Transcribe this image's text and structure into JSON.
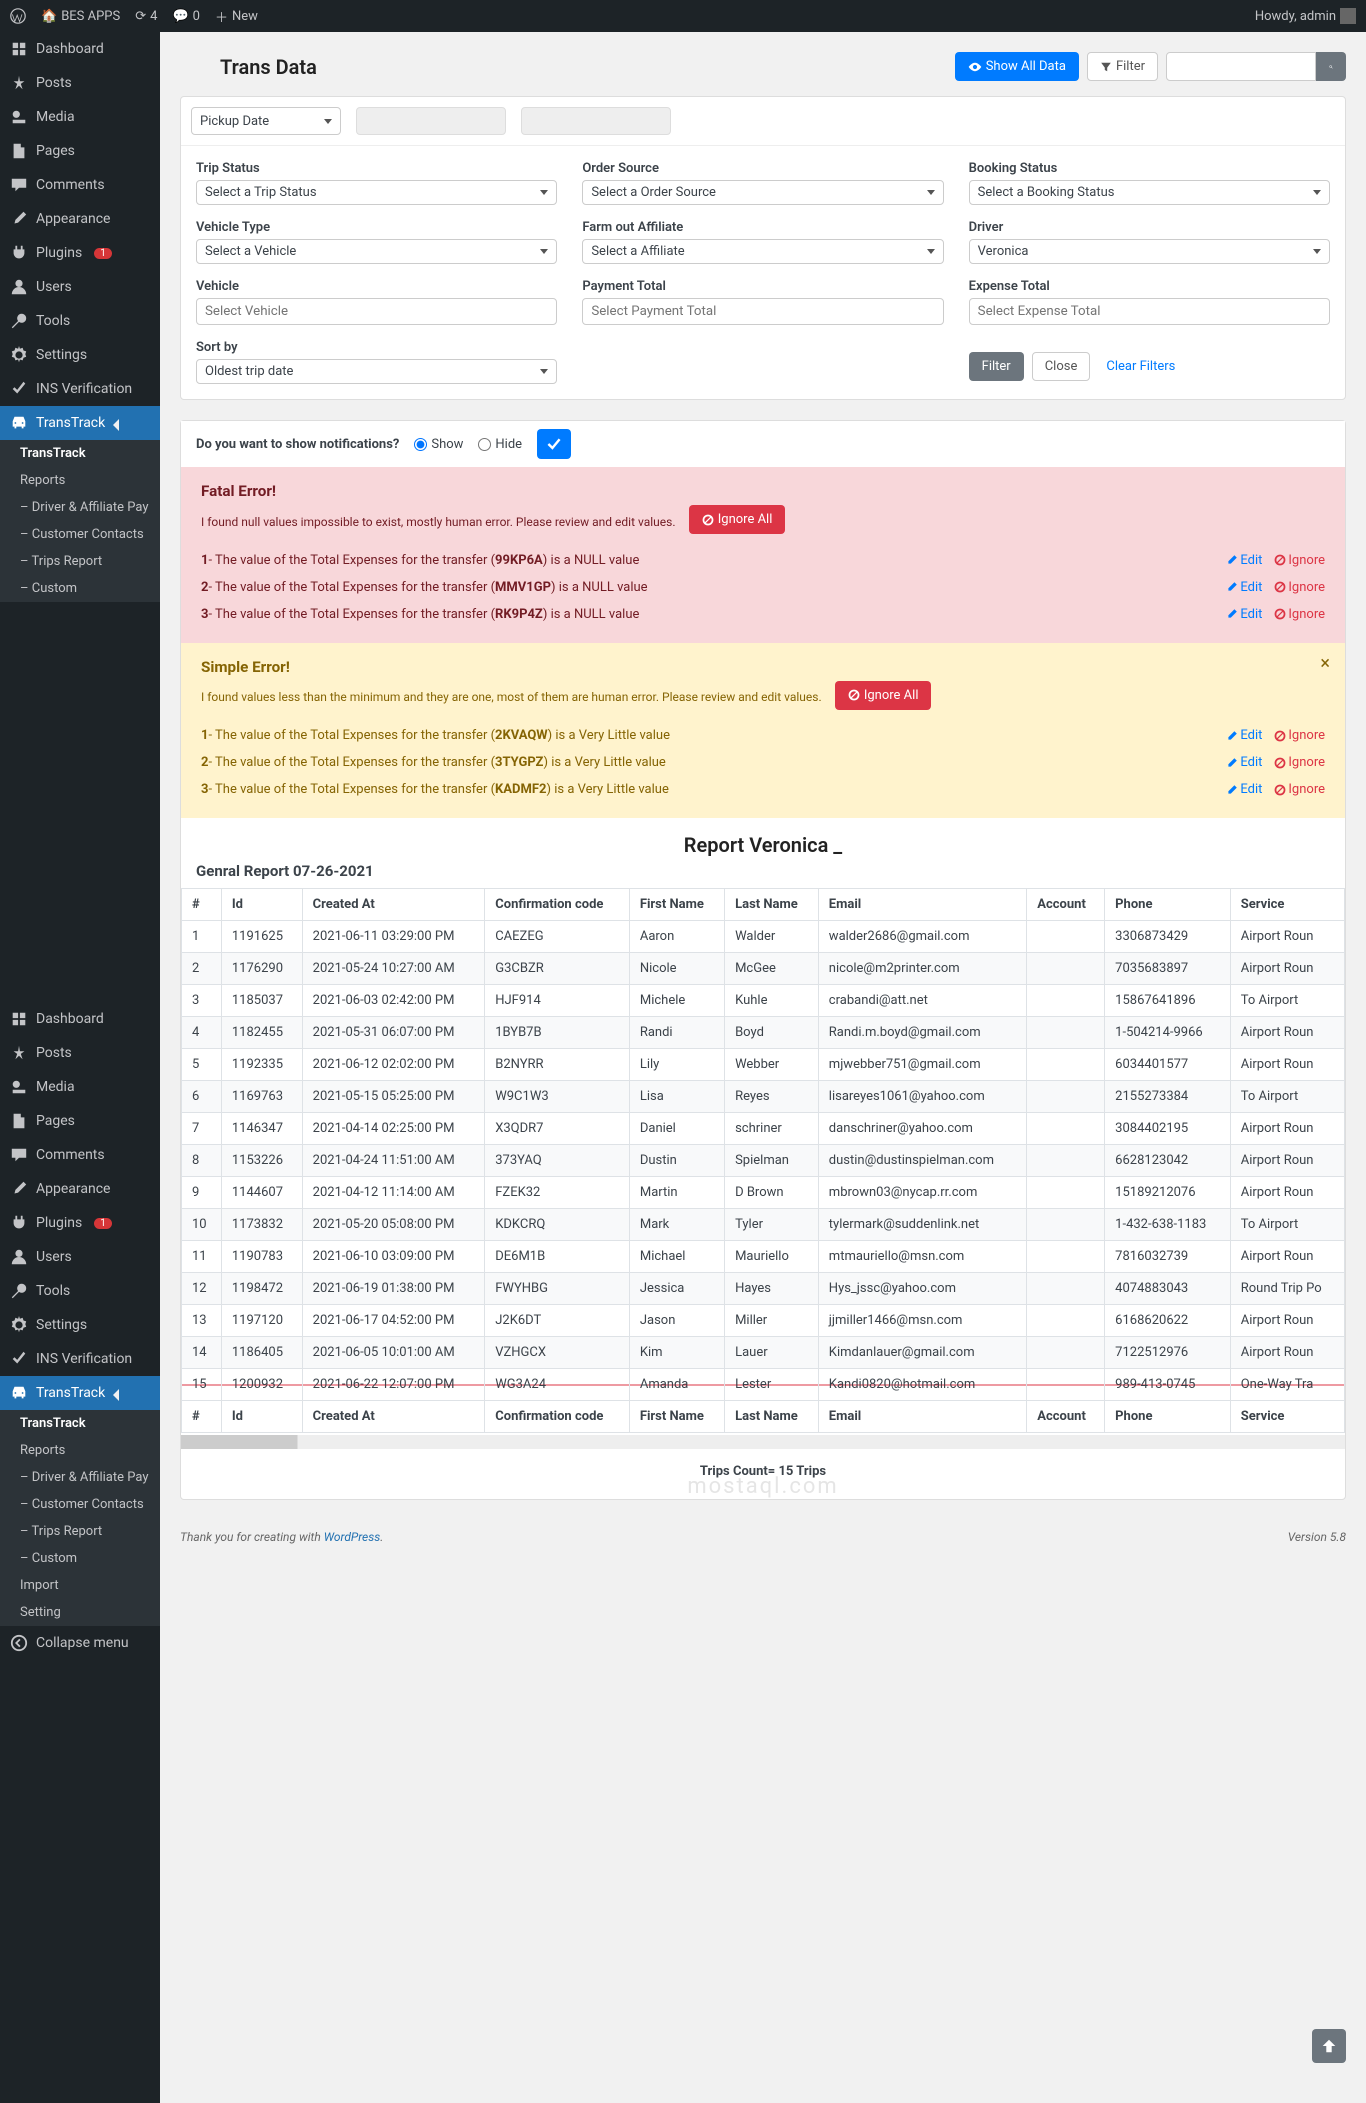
{
  "adminbar": {
    "site_name": "BES APPS",
    "updates": "4",
    "comments": "0",
    "new": "New",
    "howdy": "Howdy, admin"
  },
  "sidebar": {
    "items": [
      {
        "label": "Dashboard",
        "icon": "dash"
      },
      {
        "label": "Posts",
        "icon": "pin"
      },
      {
        "label": "Media",
        "icon": "media"
      },
      {
        "label": "Pages",
        "icon": "page"
      },
      {
        "label": "Comments",
        "icon": "comment"
      },
      {
        "label": "Appearance",
        "icon": "brush"
      },
      {
        "label": "Plugins",
        "icon": "plug",
        "badge": "1"
      },
      {
        "label": "Users",
        "icon": "user"
      },
      {
        "label": "Tools",
        "icon": "tool"
      },
      {
        "label": "Settings",
        "icon": "gear"
      },
      {
        "label": "INS Verification",
        "icon": "check"
      },
      {
        "label": "TransTrack",
        "icon": "car",
        "active": true
      }
    ],
    "submenu": [
      {
        "label": "TransTrack",
        "current": true
      },
      {
        "label": "Reports"
      },
      {
        "label": "– Driver & Affiliate Pay"
      },
      {
        "label": "– Customer Contacts"
      },
      {
        "label": "– Trips Report"
      },
      {
        "label": "– Custom"
      }
    ],
    "bottom": [
      {
        "label": "Dashboard",
        "icon": "dash"
      },
      {
        "label": "Posts",
        "icon": "pin"
      },
      {
        "label": "Media",
        "icon": "media"
      },
      {
        "label": "Pages",
        "icon": "page"
      },
      {
        "label": "Comments",
        "icon": "comment"
      },
      {
        "label": "Appearance",
        "icon": "brush"
      },
      {
        "label": "Plugins",
        "icon": "plug",
        "badge": "1"
      },
      {
        "label": "Users",
        "icon": "user"
      },
      {
        "label": "Tools",
        "icon": "tool"
      },
      {
        "label": "Settings",
        "icon": "gear"
      },
      {
        "label": "INS Verification",
        "icon": "check"
      },
      {
        "label": "TransTrack",
        "icon": "car",
        "active": true
      }
    ],
    "bottom_submenu": [
      {
        "label": "TransTrack",
        "current": true
      },
      {
        "label": "Reports"
      },
      {
        "label": "– Driver & Affiliate Pay"
      },
      {
        "label": "– Customer Contacts"
      },
      {
        "label": "– Trips Report"
      },
      {
        "label": "– Custom"
      },
      {
        "label": "Import"
      },
      {
        "label": "Setting"
      }
    ],
    "collapse": "Collapse menu"
  },
  "page": {
    "title": "Trans Data",
    "show_all": "Show All Data",
    "filter_btn": "Filter",
    "pickup_date": "Pickup Date"
  },
  "filters": {
    "trip_status": {
      "label": "Trip Status",
      "value": "Select a Trip Status"
    },
    "order_source": {
      "label": "Order Source",
      "value": "Select a Order Source"
    },
    "booking_status": {
      "label": "Booking Status",
      "value": "Select a Booking Status"
    },
    "vehicle_type": {
      "label": "Vehicle Type",
      "value": "Select a Vehicle"
    },
    "farm_out": {
      "label": "Farm out Affiliate",
      "value": "Select a Affiliate"
    },
    "driver": {
      "label": "Driver",
      "value": "Veronica"
    },
    "vehicle": {
      "label": "Vehicle",
      "placeholder": "Select Vehicle"
    },
    "payment_total": {
      "label": "Payment Total",
      "placeholder": "Select Payment Total"
    },
    "expense_total": {
      "label": "Expense Total",
      "placeholder": "Select Expense Total"
    },
    "sort_by": {
      "label": "Sort by",
      "value": "Oldest trip date"
    },
    "filter_btn": "Filter",
    "close_btn": "Close",
    "clear": "Clear Filters"
  },
  "notif": {
    "question": "Do you want to show notifications?",
    "show": "Show",
    "hide": "Hide"
  },
  "fatal": {
    "title": "Fatal Error!",
    "subtitle": "I found null values impossible to exist, mostly human error. Please review and edit values.",
    "ignore_all": "Ignore All",
    "items": [
      {
        "n": "1",
        "prefix": "- The value of the Total Expenses for the transfer (",
        "code": "99KP6A",
        "suffix": ") is a NULL value"
      },
      {
        "n": "2",
        "prefix": "- The value of the Total Expenses for the transfer (",
        "code": "MMV1GP",
        "suffix": ") is a NULL value"
      },
      {
        "n": "3",
        "prefix": "- The value of the Total Expenses for the transfer (",
        "code": "RK9P4Z",
        "suffix": ") is a NULL value"
      }
    ],
    "edit": "Edit",
    "ignore": "Ignore"
  },
  "simple": {
    "title": "Simple Error!",
    "subtitle": "I found values less than the minimum and they are one, most of them are human error. Please review and edit values.",
    "ignore_all": "Ignore All",
    "items": [
      {
        "n": "1",
        "prefix": "- The value of the Total Expenses for the transfer (",
        "code": "2KVAQW",
        "suffix": ") is a Very Little value"
      },
      {
        "n": "2",
        "prefix": "- The value of the Total Expenses for the transfer (",
        "code": "3TYGPZ",
        "suffix": ") is a Very Little value"
      },
      {
        "n": "3",
        "prefix": "- The value of the Total Expenses for the transfer (",
        "code": "KADMF2",
        "suffix": ") is a Very Little value"
      }
    ],
    "edit": "Edit",
    "ignore": "Ignore"
  },
  "report": {
    "title": "Report Veronica _",
    "subtitle": "Genral Report 07-26-2021",
    "headers": [
      "#",
      "Id",
      "Created At",
      "Confirmation code",
      "First Name",
      "Last Name",
      "Email",
      "Account",
      "Phone",
      "Service"
    ],
    "rows": [
      {
        "n": "1",
        "id": "1191625",
        "created": "2021-06-11 03:29:00 PM",
        "code": "CAEZEG",
        "first": "Aaron",
        "last": "Walder",
        "email": "walder2686@gmail.com",
        "account": "",
        "phone": "3306873429",
        "service": "Airport Roun"
      },
      {
        "n": "2",
        "id": "1176290",
        "created": "2021-05-24 10:27:00 AM",
        "code": "G3CBZR",
        "first": "Nicole",
        "last": "McGee",
        "email": "nicole@m2printer.com",
        "account": "",
        "phone": "7035683897",
        "service": "Airport Roun"
      },
      {
        "n": "3",
        "id": "1185037",
        "created": "2021-06-03 02:42:00 PM",
        "code": "HJF914",
        "first": "Michele",
        "last": "Kuhle",
        "email": "crabandi@att.net",
        "account": "",
        "phone": "15867641896",
        "service": "To Airport"
      },
      {
        "n": "4",
        "id": "1182455",
        "created": "2021-05-31 06:07:00 PM",
        "code": "1BYB7B",
        "first": "Randi",
        "last": "Boyd",
        "email": "Randi.m.boyd@gmail.com",
        "account": "",
        "phone": "1-504214-9966",
        "service": "Airport Roun"
      },
      {
        "n": "5",
        "id": "1192335",
        "created": "2021-06-12 02:02:00 PM",
        "code": "B2NYRR",
        "first": "Lily",
        "last": "Webber",
        "email": "mjwebber751@gmail.com",
        "account": "",
        "phone": "6034401577",
        "service": "Airport Roun"
      },
      {
        "n": "6",
        "id": "1169763",
        "created": "2021-05-15 05:25:00 PM",
        "code": "W9C1W3",
        "first": "Lisa",
        "last": "Reyes",
        "email": "lisareyes1061@yahoo.com",
        "account": "",
        "phone": "2155273384",
        "service": "To Airport"
      },
      {
        "n": "7",
        "id": "1146347",
        "created": "2021-04-14 02:25:00 PM",
        "code": "X3QDR7",
        "first": "Daniel",
        "last": "schriner",
        "email": "danschriner@yahoo.com",
        "account": "",
        "phone": "3084402195",
        "service": "Airport Roun"
      },
      {
        "n": "8",
        "id": "1153226",
        "created": "2021-04-24 11:51:00 AM",
        "code": "373YAQ",
        "first": "Dustin",
        "last": "Spielman",
        "email": "dustin@dustinspielman.com",
        "account": "",
        "phone": "6628123042",
        "service": "Airport Roun"
      },
      {
        "n": "9",
        "id": "1144607",
        "created": "2021-04-12 11:14:00 AM",
        "code": "FZEK32",
        "first": "Martin",
        "last": "D Brown",
        "email": "mbrown03@nycap.rr.com",
        "account": "",
        "phone": "15189212076",
        "service": "Airport Roun"
      },
      {
        "n": "10",
        "id": "1173832",
        "created": "2021-05-20 05:08:00 PM",
        "code": "KDKCRQ",
        "first": "Mark",
        "last": "Tyler",
        "email": "tylermark@suddenlink.net",
        "account": "",
        "phone": "1-432-638-1183",
        "service": "To Airport"
      },
      {
        "n": "11",
        "id": "1190783",
        "created": "2021-06-10 03:09:00 PM",
        "code": "DE6M1B",
        "first": "Michael",
        "last": "Mauriello",
        "email": "mtmauriello@msn.com",
        "account": "",
        "phone": "7816032739",
        "service": "Airport Roun"
      },
      {
        "n": "12",
        "id": "1198472",
        "created": "2021-06-19 01:38:00 PM",
        "code": "FWYHBG",
        "first": "Jessica",
        "last": "Hayes",
        "email": "Hys_jssc@yahoo.com",
        "account": "",
        "phone": "4074883043",
        "service": "Round Trip Po"
      },
      {
        "n": "13",
        "id": "1197120",
        "created": "2021-06-17 04:52:00 PM",
        "code": "J2K6DT",
        "first": "Jason",
        "last": "Miller",
        "email": "jjmiller1466@msn.com",
        "account": "",
        "phone": "6168620622",
        "service": "Airport Roun"
      },
      {
        "n": "14",
        "id": "1186405",
        "created": "2021-06-05 10:01:00 AM",
        "code": "VZHGCX",
        "first": "Kim",
        "last": "Lauer",
        "email": "Kimdanlauer@gmail.com",
        "account": "",
        "phone": "7122512976",
        "service": "Airport Roun"
      },
      {
        "n": "15",
        "id": "1200932",
        "created": "2021-06-22 12:07:00 PM",
        "code": "WG3A24",
        "first": "Amanda",
        "last": "Lester",
        "email": "Kandi0820@hotmail.com",
        "account": "",
        "phone": "989-413-0745",
        "service": "One-Way Tra",
        "strike": true
      }
    ],
    "count": "Trips Count= 15 Trips"
  },
  "footer": {
    "thank": "Thank you for creating with ",
    "wp": "WordPress",
    "version": "Version 5.8"
  },
  "watermark": "mostaql.com"
}
